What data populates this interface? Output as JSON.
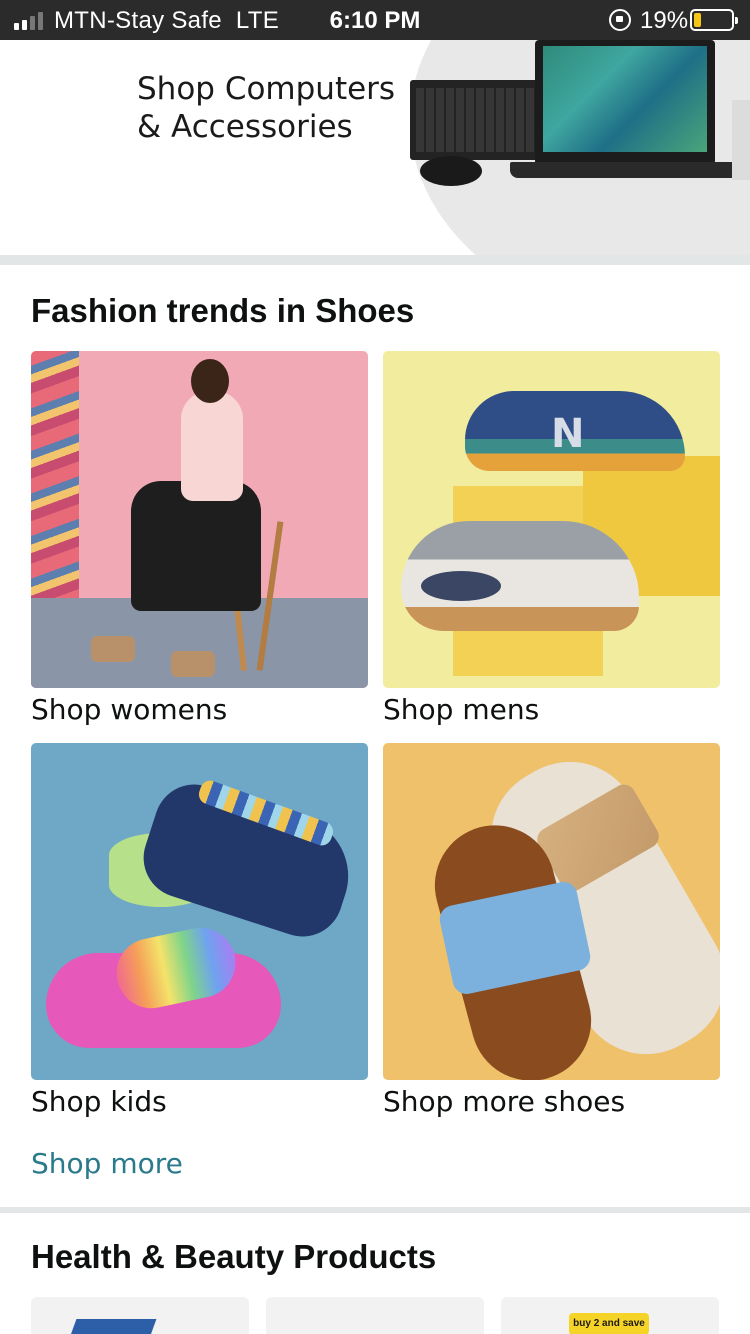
{
  "status_bar": {
    "carrier": "MTN-Stay Safe",
    "network": "LTE",
    "time": "6:10 PM",
    "battery_percent_text": "19%",
    "battery_level": 0.19
  },
  "banner": {
    "title": "Shop Computers\n& Accessories"
  },
  "shoes_section": {
    "title": "Fashion trends in Shoes",
    "cards": [
      {
        "label": "Shop womens"
      },
      {
        "label": "Shop mens"
      },
      {
        "label": "Shop kids"
      },
      {
        "label": "Shop more shoes"
      }
    ],
    "shop_more": "Shop more"
  },
  "health_section": {
    "title": "Health & Beauty Products",
    "promo_tag": "buy 2 and save"
  },
  "colors": {
    "link": "#2a7a8c",
    "separator": "#e3e6e6",
    "status_bar_bg": "#2b2b2b",
    "battery": "#f5c518"
  }
}
